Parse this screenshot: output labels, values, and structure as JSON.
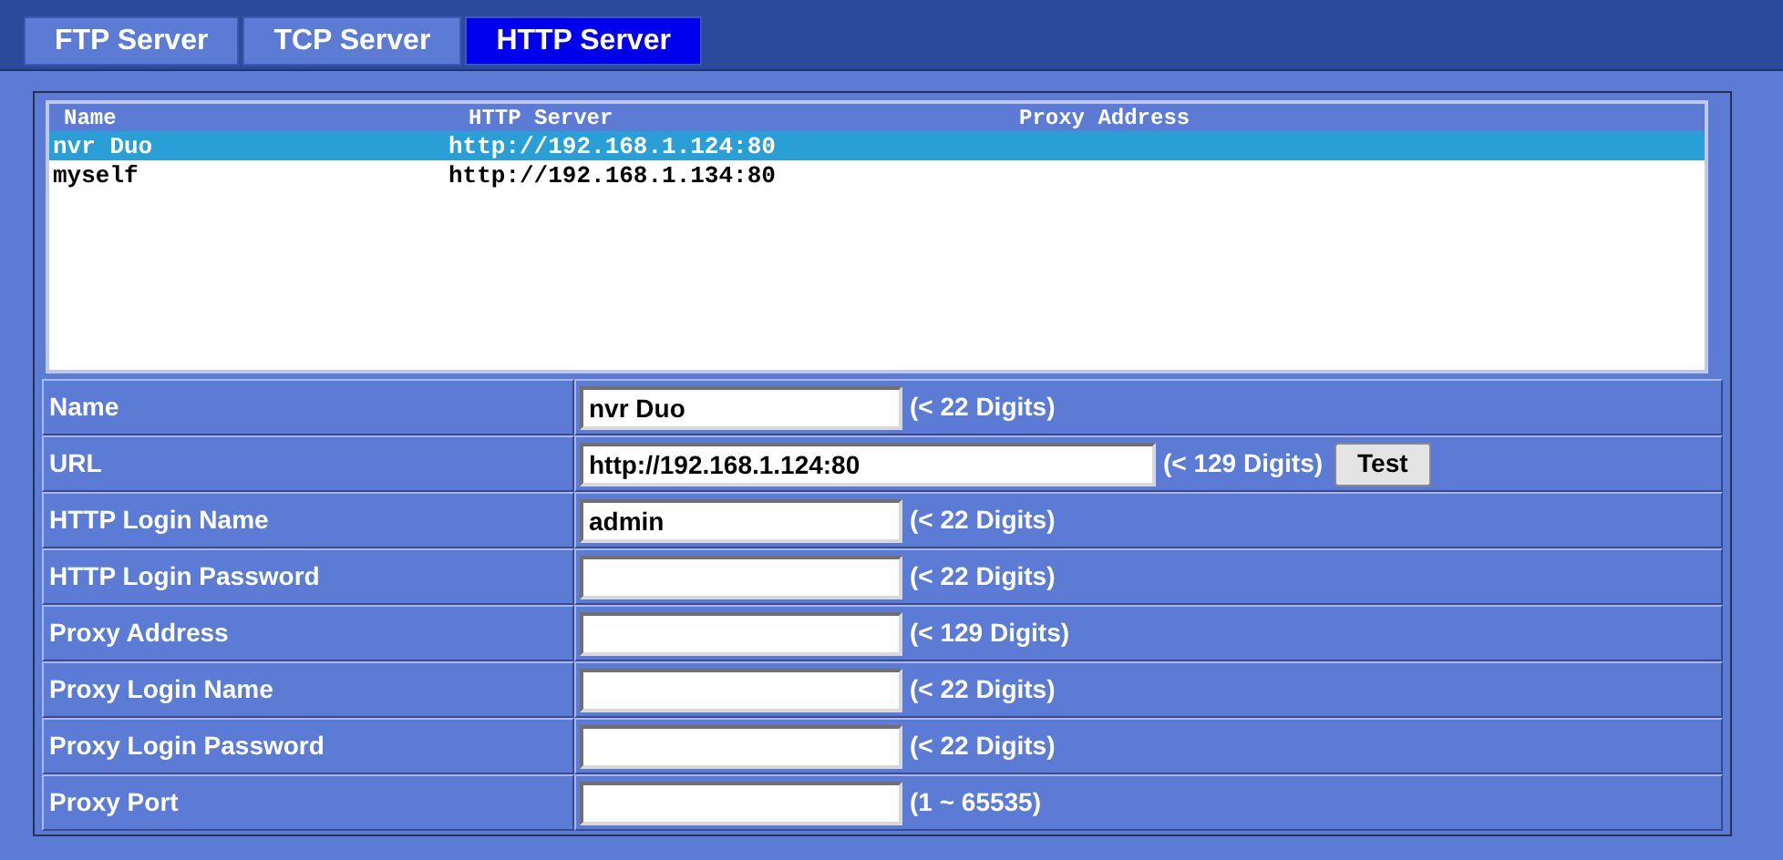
{
  "tabs": [
    {
      "label": "FTP Server",
      "selected": false
    },
    {
      "label": "TCP Server",
      "selected": false
    },
    {
      "label": "HTTP Server",
      "selected": true
    }
  ],
  "server_list": {
    "columns": [
      "Name",
      "HTTP Server",
      "Proxy Address"
    ],
    "rows": [
      {
        "cells": [
          "nvr Duo",
          "http://192.168.1.124:80"
        ],
        "selected": true
      },
      {
        "cells": [
          "myself",
          "http://192.168.1.134:80"
        ],
        "selected": false
      }
    ]
  },
  "form": [
    {
      "kind": "text",
      "label": "Name",
      "value": "nvr Duo",
      "hint": "(< 22 Digits)"
    },
    {
      "kind": "text_with_button",
      "label": "URL",
      "value": "http://192.168.1.124:80",
      "hint": "(< 129 Digits)",
      "button": "Test"
    },
    {
      "kind": "text",
      "label": "HTTP Login Name",
      "value": "admin",
      "hint": "(< 22 Digits)"
    },
    {
      "kind": "text",
      "label": "HTTP Login Password",
      "hint": "(< 22 Digits)"
    },
    {
      "kind": "text",
      "label": "Proxy Address",
      "hint": "(< 129 Digits)"
    },
    {
      "kind": "text",
      "label": "Proxy Login Name",
      "hint": "(< 22 Digits)"
    },
    {
      "kind": "text",
      "label": "Proxy Login Password",
      "hint": "(< 22 Digits)"
    },
    {
      "kind": "text",
      "label": "Proxy Port",
      "hint": "(1 ~ 65535)"
    }
  ]
}
